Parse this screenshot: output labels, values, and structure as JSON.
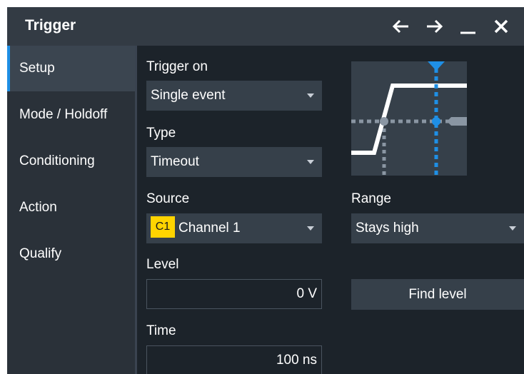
{
  "window": {
    "title": "Trigger",
    "controls": [
      "arrow-left-icon",
      "arrow-right-icon",
      "minimize-icon",
      "close-icon"
    ]
  },
  "sidebar": {
    "items": [
      {
        "label": "Setup",
        "active": true
      },
      {
        "label": "Mode / Holdoff",
        "active": false
      },
      {
        "label": "Conditioning",
        "active": false
      },
      {
        "label": "Action",
        "active": false
      },
      {
        "label": "Qualify",
        "active": false
      }
    ]
  },
  "setup": {
    "trigger_on_label": "Trigger on",
    "trigger_on_value": "Single event",
    "type_label": "Type",
    "type_value": "Timeout",
    "source_label": "Source",
    "source_badge": "C1",
    "source_value": "Channel 1",
    "range_label": "Range",
    "range_value": "Stays high",
    "level_label": "Level",
    "level_value": "0 V",
    "find_level_label": "Find level",
    "time_label": "Time",
    "time_value": "100 ns"
  },
  "colors": {
    "accent": "#1f8fe5",
    "channel1": "#ffd400",
    "background": "#1c232a",
    "sidebar": "#2a3139",
    "titlebar": "#333b44"
  }
}
